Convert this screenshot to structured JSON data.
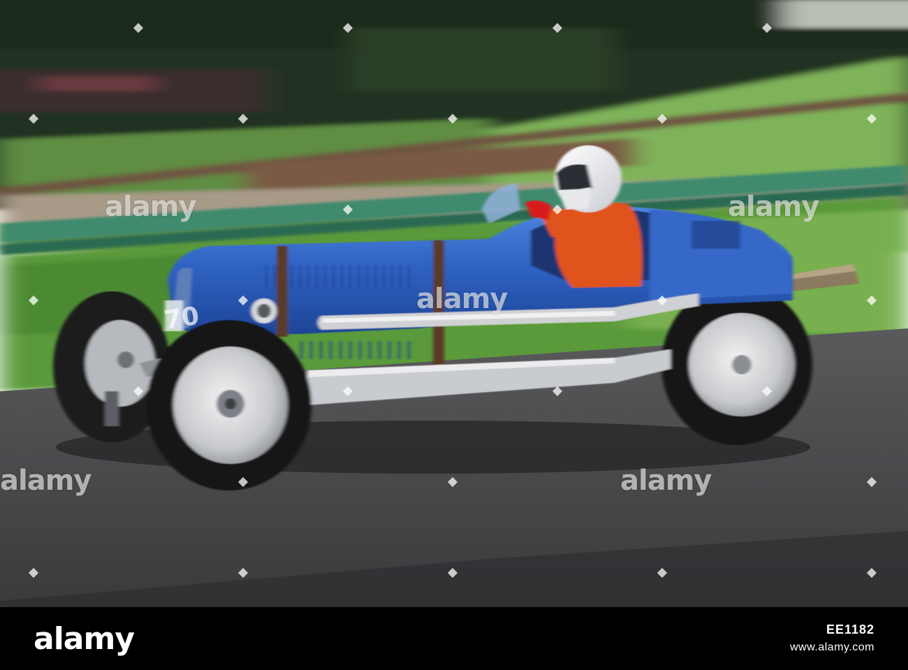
{
  "watermark": {
    "text": "alamy"
  },
  "footer": {
    "logo": "alamy",
    "image_id": "EE1182",
    "site": "www.alamy.com"
  },
  "car": {
    "number": "70"
  },
  "colors": {
    "car_body": "#2f5fbf",
    "suit": "#e1521d",
    "grass": "#5e9a3b",
    "track": "#4b4b4e",
    "footer_bg": "#000000"
  }
}
